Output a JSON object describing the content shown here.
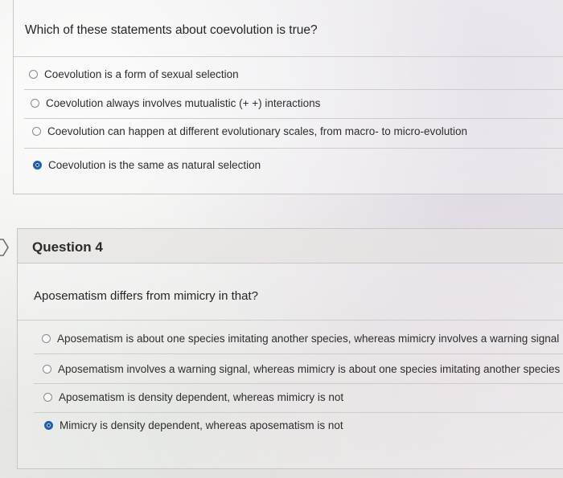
{
  "question3": {
    "prompt": "Which of these statements about coevolution is true?",
    "options": [
      {
        "label": "Coevolution is a form of sexual selection",
        "selected": false
      },
      {
        "label": "Coevolution always involves mutualistic (+ +) interactions",
        "selected": false
      },
      {
        "label": "Coevolution can happen at different evolutionary scales, from macro- to micro-evolution",
        "selected": false
      },
      {
        "label": "Coevolution is the same as natural selection",
        "selected": true
      }
    ]
  },
  "question4": {
    "title": "Question 4",
    "prompt": "Aposematism differs from mimicry in that?",
    "options": [
      {
        "label": "Aposematism is about one species imitating another species, whereas mimicry involves a warning signal",
        "selected": false
      },
      {
        "label": "Aposematism involves a warning signal, whereas mimicry is about one species imitating another species",
        "selected": false
      },
      {
        "label": "Aposematism is density dependent, whereas mimicry is not",
        "selected": false
      },
      {
        "label": "Mimicry is density dependent, whereas aposematism is not",
        "selected": true
      }
    ]
  },
  "colors": {
    "selected_radio": "#1f5fae",
    "border": "#c9c7c4"
  }
}
